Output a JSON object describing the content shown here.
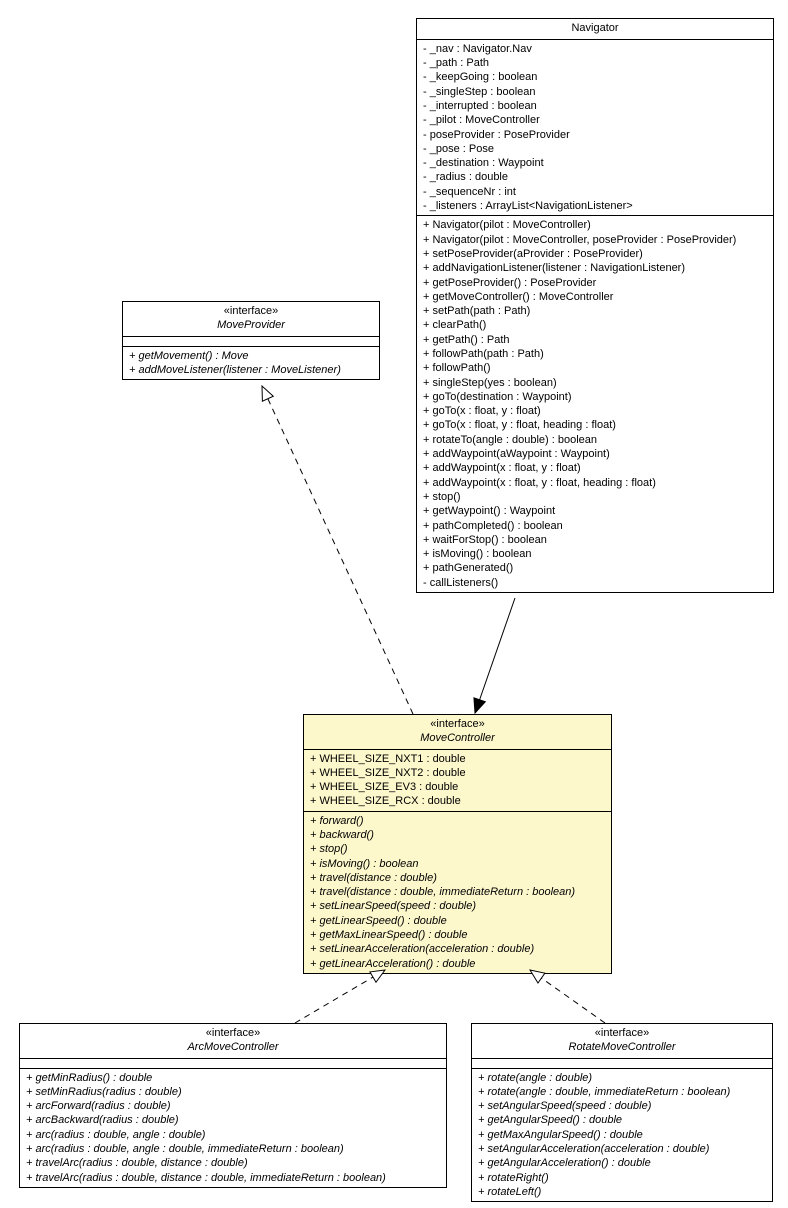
{
  "moveProvider": {
    "stereotype": "«interface»",
    "name": "MoveProvider",
    "methods": [
      "+ getMovement() : Move",
      "+ addMoveListener(listener : MoveListener)"
    ]
  },
  "navigator": {
    "name": "Navigator",
    "attrs": [
      "- _nav : Navigator.Nav",
      "- _path : Path",
      "- _keepGoing : boolean",
      "- _singleStep : boolean",
      "- _interrupted : boolean",
      "- _pilot : MoveController",
      "- poseProvider : PoseProvider",
      "- _pose : Pose",
      "- _destination : Waypoint",
      "- _radius : double",
      "- _sequenceNr : int",
      "- _listeners : ArrayList<NavigationListener>"
    ],
    "methods": [
      "+ Navigator(pilot : MoveController)",
      "+ Navigator(pilot : MoveController, poseProvider : PoseProvider)",
      "+ setPoseProvider(aProvider : PoseProvider)",
      "+ addNavigationListener(listener : NavigationListener)",
      "+ getPoseProvider() : PoseProvider",
      "+ getMoveController() : MoveController",
      "+ setPath(path : Path)",
      "+ clearPath()",
      "+ getPath() : Path",
      "+ followPath(path : Path)",
      "+ followPath()",
      "+ singleStep(yes : boolean)",
      "+ goTo(destination : Waypoint)",
      "+ goTo(x : float, y : float)",
      "+ goTo(x : float, y : float, heading : float)",
      "+ rotateTo(angle : double) : boolean",
      "+ addWaypoint(aWaypoint : Waypoint)",
      "+ addWaypoint(x : float, y : float)",
      "+ addWaypoint(x : float, y : float, heading : float)",
      "+ stop()",
      "+ getWaypoint() : Waypoint",
      "+ pathCompleted() : boolean",
      "+ waitForStop() : boolean",
      "+ isMoving() : boolean",
      "+ pathGenerated()",
      "- callListeners()"
    ]
  },
  "moveController": {
    "stereotype": "«interface»",
    "name": "MoveController",
    "attrs": [
      "+ WHEEL_SIZE_NXT1 : double",
      "+ WHEEL_SIZE_NXT2 : double",
      "+ WHEEL_SIZE_EV3 : double",
      "+ WHEEL_SIZE_RCX : double"
    ],
    "methods": [
      "+ forward()",
      "+ backward()",
      "+ stop()",
      "+ isMoving() : boolean",
      "+ travel(distance : double)",
      "+ travel(distance : double, immediateReturn : boolean)",
      "+ setLinearSpeed(speed : double)",
      "+ getLinearSpeed() : double",
      "+ getMaxLinearSpeed() : double",
      "+ setLinearAcceleration(acceleration : double)",
      "+ getLinearAcceleration() : double"
    ]
  },
  "arcMoveController": {
    "stereotype": "«interface»",
    "name": "ArcMoveController",
    "methods": [
      "+ getMinRadius() : double",
      "+ setMinRadius(radius : double)",
      "+ arcForward(radius : double)",
      "+ arcBackward(radius : double)",
      "+ arc(radius : double, angle : double)",
      "+ arc(radius : double, angle : double, immediateReturn : boolean)",
      "+ travelArc(radius : double, distance : double)",
      "+ travelArc(radius : double, distance : double, immediateReturn : boolean)"
    ]
  },
  "rotateMoveController": {
    "stereotype": "«interface»",
    "name": "RotateMoveController",
    "methods": [
      "+ rotate(angle : double)",
      "+ rotate(angle : double, immediateReturn : boolean)",
      "+ setAngularSpeed(speed : double)",
      "+ getAngularSpeed() : double",
      "+ getMaxAngularSpeed() : double",
      "+ setAngularAcceleration(acceleration : double)",
      "+ getAngularAcceleration() : double",
      "+ rotateRight()",
      "+ rotateLeft()"
    ]
  }
}
